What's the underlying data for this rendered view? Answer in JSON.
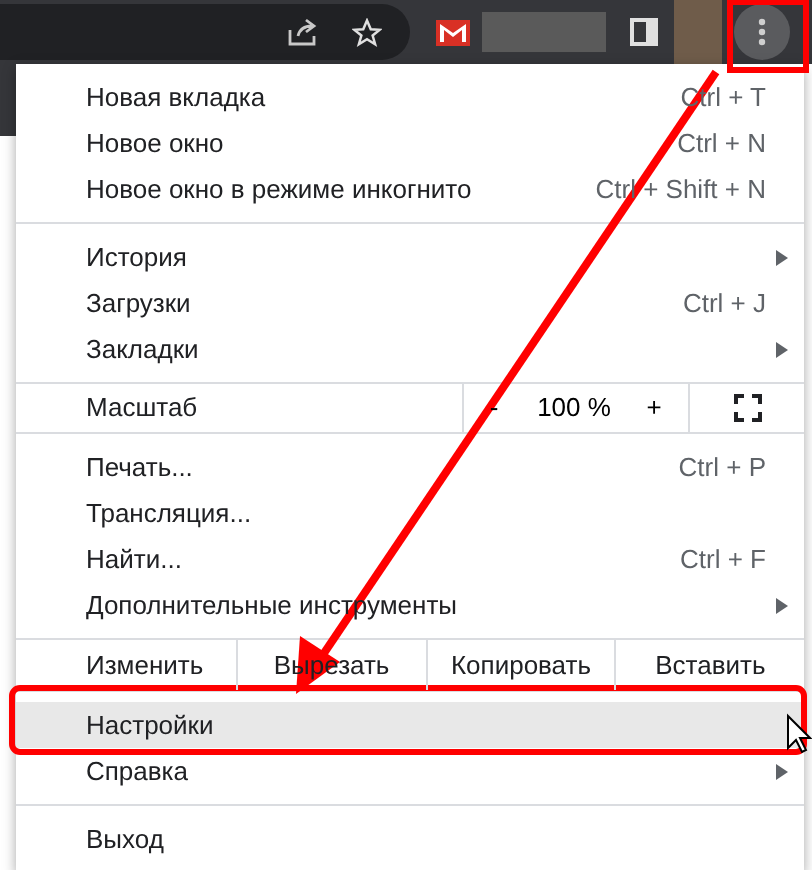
{
  "menu": {
    "groups": [
      {
        "items": [
          {
            "kind": "item",
            "label": "Новая вкладка",
            "shortcut": "Ctrl + T",
            "submenu": false,
            "highlighted": false
          },
          {
            "kind": "item",
            "label": "Новое окно",
            "shortcut": "Ctrl + N",
            "submenu": false,
            "highlighted": false
          },
          {
            "kind": "item",
            "label": "Новое окно в режиме инкогнито",
            "shortcut": "Ctrl + Shift + N",
            "submenu": false,
            "highlighted": false
          }
        ]
      },
      {
        "items": [
          {
            "kind": "item",
            "label": "История",
            "submenu": true,
            "highlighted": false
          },
          {
            "kind": "item",
            "label": "Загрузки",
            "shortcut": "Ctrl + J",
            "submenu": false,
            "highlighted": false
          },
          {
            "kind": "item",
            "label": "Закладки",
            "submenu": true,
            "highlighted": false
          }
        ]
      },
      {
        "items": [
          {
            "kind": "zoom",
            "label": "Масштаб",
            "minus": "-",
            "value": "100 %",
            "plus": "+"
          }
        ]
      },
      {
        "items": [
          {
            "kind": "item",
            "label": "Печать...",
            "shortcut": "Ctrl + P",
            "submenu": false,
            "highlighted": false
          },
          {
            "kind": "item",
            "label": "Трансляция...",
            "submenu": false,
            "highlighted": false
          },
          {
            "kind": "item",
            "label": "Найти...",
            "shortcut": "Ctrl + F",
            "submenu": false,
            "highlighted": false
          },
          {
            "kind": "item",
            "label": "Дополнительные инструменты",
            "submenu": true,
            "highlighted": false
          }
        ]
      },
      {
        "items": [
          {
            "kind": "edit",
            "label": "Изменить",
            "buttons": [
              "Вырезать",
              "Копировать",
              "Вставить"
            ]
          }
        ]
      },
      {
        "items": [
          {
            "kind": "item",
            "label": "Настройки",
            "submenu": false,
            "highlighted": true
          },
          {
            "kind": "item",
            "label": "Справка",
            "submenu": true,
            "highlighted": false
          }
        ]
      },
      {
        "items": [
          {
            "kind": "item",
            "label": "Выход",
            "submenu": false,
            "highlighted": false
          }
        ]
      }
    ]
  }
}
